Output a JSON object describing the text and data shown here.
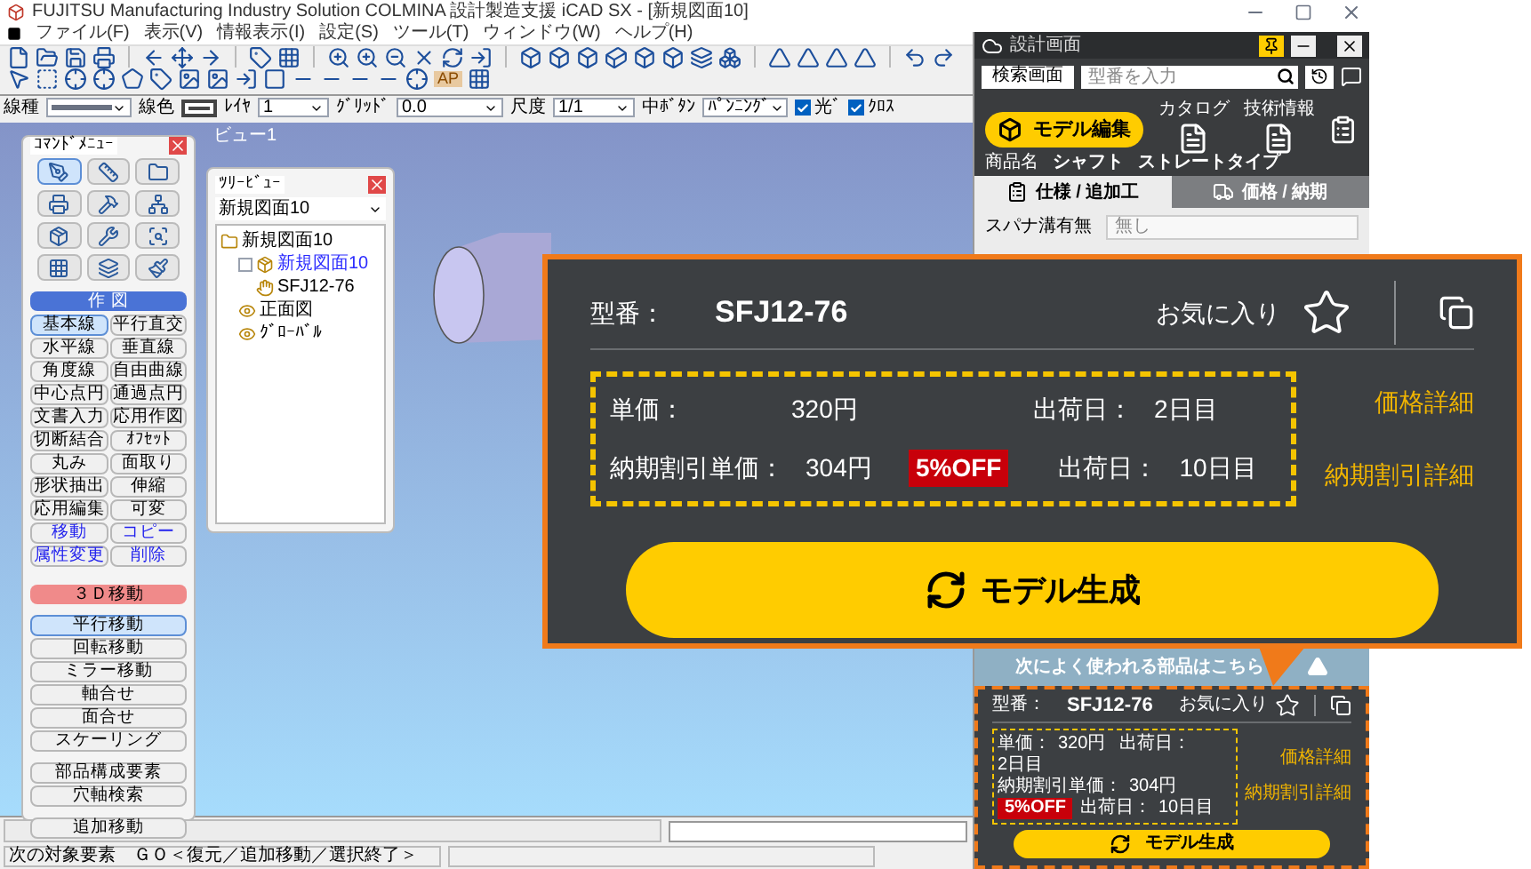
{
  "window": {
    "title": "FUJITSU Manufacturing Industry Solution COLMINA 設計製造支援 iCAD SX - [新規図面10]"
  },
  "menu": [
    "ファイル(F)",
    "表示(V)",
    "情報表示(I)",
    "設定(S)",
    "ツール(T)",
    "ウィンドウ(W)",
    "ヘルプ(H)"
  ],
  "toolbar_badge": "AP",
  "options": {
    "line_type_label": "線種",
    "line_color_label": "線色",
    "layer_label": "ﾚｲﾔ",
    "layer": "1",
    "grid_label": "ｸﾞﾘｯﾄﾞ",
    "grid": "0.0",
    "scale_label": "尺度",
    "scale": "1/1",
    "middle_button_label": "中ﾎﾞﾀﾝ",
    "middle_button": "ﾊﾟﾝﾆﾝｸﾞ",
    "checks": [
      {
        "label": "光ﾞ",
        "checked": true
      },
      {
        "label": "ｸﾛｽ",
        "checked": true
      }
    ]
  },
  "view_tab": "ビュー1",
  "command_menu": {
    "title": "ｺﾏﾝﾄﾞﾒﾆｭｰ",
    "draw_section": {
      "title": "作 図",
      "buttons": [
        {
          "label": "基本線",
          "selected": true,
          "kind": "plain"
        },
        {
          "label": "平行直交",
          "selected": false,
          "kind": "plain"
        },
        {
          "label": "水平線",
          "selected": false,
          "kind": "plain"
        },
        {
          "label": "垂直線",
          "selected": false,
          "kind": "plain"
        },
        {
          "label": "角度線",
          "selected": false,
          "kind": "plain"
        },
        {
          "label": "自由曲線",
          "selected": false,
          "kind": "plain"
        },
        {
          "label": "中心点円",
          "selected": false,
          "kind": "plain"
        },
        {
          "label": "通過点円",
          "selected": false,
          "kind": "plain"
        },
        {
          "label": "文書入力",
          "selected": false,
          "kind": "plain"
        },
        {
          "label": "応用作図",
          "selected": false,
          "kind": "plain"
        },
        {
          "label": "切断結合",
          "selected": false,
          "kind": "plain"
        },
        {
          "label": "ｵﾌｾｯﾄ",
          "selected": false,
          "kind": "plain"
        },
        {
          "label": "丸み",
          "selected": false,
          "kind": "plain"
        },
        {
          "label": "面取り",
          "selected": false,
          "kind": "plain"
        },
        {
          "label": "形状抽出",
          "selected": false,
          "kind": "plain"
        },
        {
          "label": "伸縮",
          "selected": false,
          "kind": "plain"
        },
        {
          "label": "応用編集",
          "selected": false,
          "kind": "plain"
        },
        {
          "label": "可変",
          "selected": false,
          "kind": "plain"
        },
        {
          "label": "移動",
          "selected": false,
          "kind": "edit"
        },
        {
          "label": "コピー",
          "selected": false,
          "kind": "edit"
        },
        {
          "label": "属性変更",
          "selected": false,
          "kind": "edit"
        },
        {
          "label": "削除",
          "selected": false,
          "kind": "edit"
        }
      ]
    },
    "move_section": {
      "title": "３Ｄ移動",
      "groups": [
        [
          {
            "label": "平行移動",
            "selected": true
          },
          {
            "label": "回転移動",
            "selected": false
          },
          {
            "label": "ミラー移動",
            "selected": false
          },
          {
            "label": "軸合せ",
            "selected": false
          },
          {
            "label": "面合せ",
            "selected": false
          },
          {
            "label": "スケーリング",
            "selected": false
          }
        ],
        [
          {
            "label": "部品構成要素",
            "selected": false
          },
          {
            "label": "穴軸検索",
            "selected": false
          }
        ],
        [
          {
            "label": "追加移動",
            "selected": false
          }
        ]
      ]
    }
  },
  "tree_view": {
    "title": "ﾂﾘｰﾋﾞｭｰ",
    "dropdown": "新規図面10",
    "items": [
      {
        "label": "新規図面10",
        "kind": "folder",
        "selected": false,
        "children": [
          {
            "label": "新規図面10",
            "kind": "part",
            "selected": true,
            "children": [
              {
                "label": "SFJ12-76",
                "kind": "hand",
                "selected": false
              }
            ]
          },
          {
            "label": "正面図",
            "kind": "view",
            "selected": false
          },
          {
            "label": "ｸﾞﾛｰﾊﾞﾙ",
            "kind": "view",
            "selected": false
          }
        ]
      }
    ]
  },
  "status_bar": {
    "message": "次の対象要素　ＧＯ＜復元／追加移動／選択終了＞"
  },
  "side_panel": {
    "title": "設計画面",
    "search_button": "検索画面",
    "search": {
      "placeholder": "型番を入力"
    },
    "edit_button": "モデル編集",
    "documents": [
      {
        "label": "カタログ"
      },
      {
        "label": "技術情報"
      }
    ],
    "product": {
      "label": "商品名",
      "name": "シャフト",
      "type": "ストレートタイプ"
    },
    "tabs": [
      {
        "label": "仕様 / 追加工",
        "selected": true
      },
      {
        "label": "価格 / 納期",
        "selected": false
      }
    ],
    "fields": [
      {
        "label": "スパナ溝有無",
        "value": "無し"
      }
    ],
    "suggestion": "次によく使われる部品はこちら"
  },
  "detail_card": {
    "model_label": "型番：",
    "model": "SFJ12-76",
    "favorite": "お気に入り",
    "rows": [
      {
        "label": "単価：",
        "price": "320円",
        "ship_label": "出荷日：",
        "ship": "2日目",
        "link": "価格詳細"
      },
      {
        "label": "納期割引単価：",
        "price": "304円",
        "badge": "5%OFF",
        "ship_label": "出荷日：",
        "ship": "10日目",
        "link": "納期割引詳細"
      }
    ],
    "generate_button": "モデル生成"
  },
  "zoom_callout": {
    "model_label": "型番：",
    "model": "SFJ12-76",
    "favorite": "お気に入り",
    "rows": [
      {
        "label": "単価：",
        "price": "320円",
        "ship_label": "出荷日：",
        "ship": "2日目",
        "link": "価格詳細"
      },
      {
        "label": "納期割引単価：",
        "price": "304円",
        "badge": "5%OFF",
        "ship_label": "出荷日：",
        "ship": "10日目",
        "link": "納期割引詳細"
      }
    ],
    "generate_button": "モデル生成"
  }
}
